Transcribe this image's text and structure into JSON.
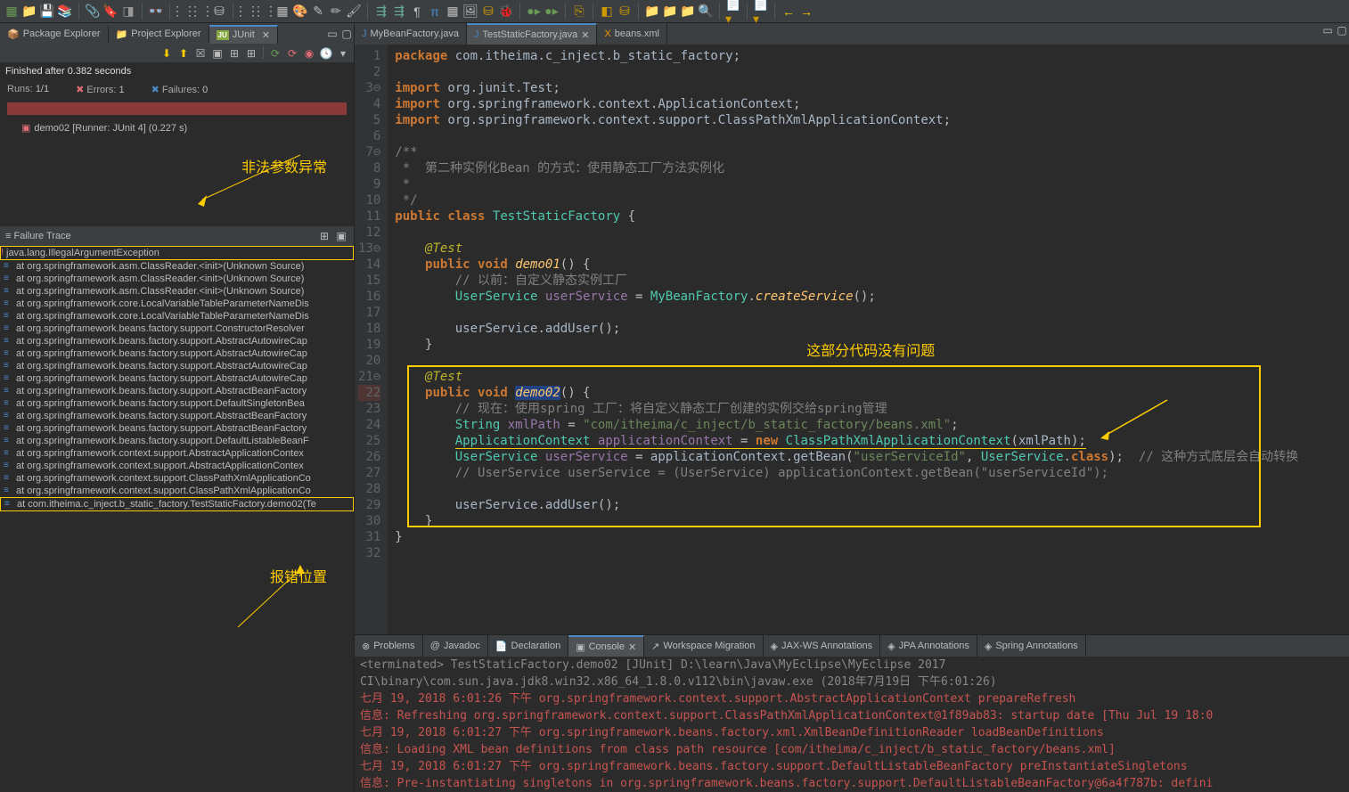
{
  "toolbar_icons": [
    "new",
    "folder",
    "save",
    "saveall",
    "sep",
    "attach",
    "tag",
    "build",
    "debug",
    "run",
    "sep2",
    "glasses",
    "docs",
    "indent",
    "outdent",
    "wrap",
    "sep3",
    "file",
    "file2",
    "grid",
    "palette",
    "edit",
    "pencil",
    "brush",
    "sep4",
    "run2",
    "pause",
    "para",
    "pi",
    "bold",
    "img",
    "db",
    "bug",
    "sep5",
    "play",
    "debug2",
    "sep6",
    "git",
    "sep7",
    "cube",
    "cubes",
    "sep8",
    "folder-g",
    "folder-y",
    "folder-o",
    "search",
    "sep9",
    "doc",
    "down",
    "sep10",
    "doc2",
    "down2",
    "sep11",
    "back",
    "fwd"
  ],
  "left_tabs": [
    {
      "icon": "📦",
      "label": "Package Explorer",
      "active": false
    },
    {
      "icon": "📁",
      "label": "Project Explorer",
      "active": false
    },
    {
      "icon": "Ju",
      "label": "JUnit",
      "active": true
    }
  ],
  "junit": {
    "finished": "Finished after 0.382 seconds",
    "runs_label": "Runs:",
    "runs_val": "1/1",
    "errors_label": "Errors:",
    "errors_val": "1",
    "failures_label": "Failures:",
    "failures_val": "0",
    "test_item": "demo02 [Runner: JUnit 4] (0.227 s)",
    "annotation_exception": "非法参数异常",
    "failure_trace_header": "Failure Trace",
    "exception": "java.lang.IllegalArgumentException",
    "trace": [
      "at org.springframework.asm.ClassReader.<init>(Unknown Source)",
      "at org.springframework.asm.ClassReader.<init>(Unknown Source)",
      "at org.springframework.asm.ClassReader.<init>(Unknown Source)",
      "at org.springframework.core.LocalVariableTableParameterNameDis",
      "at org.springframework.core.LocalVariableTableParameterNameDis",
      "at org.springframework.beans.factory.support.ConstructorResolver",
      "at org.springframework.beans.factory.support.AbstractAutowireCap",
      "at org.springframework.beans.factory.support.AbstractAutowireCap",
      "at org.springframework.beans.factory.support.AbstractAutowireCap",
      "at org.springframework.beans.factory.support.AbstractAutowireCap",
      "at org.springframework.beans.factory.support.AbstractBeanFactory",
      "at org.springframework.beans.factory.support.DefaultSingletonBea",
      "at org.springframework.beans.factory.support.AbstractBeanFactory",
      "at org.springframework.beans.factory.support.AbstractBeanFactory",
      "at org.springframework.beans.factory.support.DefaultListableBeanF",
      "at org.springframework.context.support.AbstractApplicationContex",
      "at org.springframework.context.support.AbstractApplicationContex",
      "at org.springframework.context.support.ClassPathXmlApplicationCo",
      "at org.springframework.context.support.ClassPathXmlApplicationCo"
    ],
    "trace_own": "at com.itheima.c_inject.b_static_factory.TestStaticFactory.demo02(Te",
    "annotation_pos": "报错位置"
  },
  "editor_tabs": [
    {
      "icon": "J",
      "label": "MyBeanFactory.java",
      "active": false
    },
    {
      "icon": "J",
      "label": "TestStaticFactory.java",
      "active": true
    },
    {
      "icon": "X",
      "label": "beans.xml",
      "active": false
    }
  ],
  "code_lines": [
    1,
    2,
    3,
    4,
    5,
    6,
    7,
    8,
    9,
    10,
    11,
    12,
    13,
    14,
    15,
    16,
    17,
    18,
    19,
    20,
    21,
    22,
    23,
    24,
    25,
    26,
    27,
    28,
    29,
    30,
    31,
    32
  ],
  "code": {
    "pkg": "package",
    "pkg_path": "com.itheima.c_inject.b_static_factory",
    "imp": "import",
    "imp1": "org.junit.Test",
    "imp2": "org.springframework.context.ApplicationContext",
    "imp3": "org.springframework.context.support.ClassPathXmlApplicationContext",
    "c1": "/**",
    "c2": " *  第二种实例化Bean 的方式：使用静态工厂方法实例化",
    "c3": " * ",
    "c4": " */",
    "pub": "public",
    "cls": "class",
    "clsname": "TestStaticFactory",
    "test_ann": "@Test",
    "void": "void",
    "m1": "demo01",
    "m2": "demo02",
    "c5": "// 以前：自定义静态实例工厂",
    "us": "UserService",
    "var_us": "userService",
    "mbf": "MyBeanFactory",
    "cs": "createService",
    "addUser": "addUser",
    "c6": "// 现在：使用spring 工厂：将自定义静态工厂创建的实例交给spring管理",
    "str": "String",
    "xmlPath": "xmlPath",
    "xmlVal": "\"com/itheima/c_inject/b_static_factory/beans.xml\"",
    "ac": "ApplicationContext",
    "acv": "applicationContext",
    "new": "new",
    "cpxac": "ClassPathXmlApplicationContext",
    "getBean": "getBean",
    "usid": "\"userServiceId\"",
    "classkw": "class",
    "c7": "// 这种方式底层会自动转换",
    "c8": "// UserService userService = (UserService) applicationContext.getBean(\"userServiceId\");"
  },
  "annotation_code": "这部分代码没有问题",
  "console_tabs": [
    {
      "icon": "⊗",
      "label": "Problems"
    },
    {
      "icon": "@",
      "label": "Javadoc"
    },
    {
      "icon": "📄",
      "label": "Declaration"
    },
    {
      "icon": "▣",
      "label": "Console",
      "active": true
    },
    {
      "icon": "↗",
      "label": "Workspace Migration"
    },
    {
      "icon": "◈",
      "label": "JAX-WS Annotations"
    },
    {
      "icon": "◈",
      "label": "JPA Annotations"
    },
    {
      "icon": "◈",
      "label": "Spring Annotations"
    }
  ],
  "console": {
    "term": "<terminated> TestStaticFactory.demo02 [JUnit] D:\\learn\\Java\\MyEclipse\\MyEclipse 2017 CI\\binary\\com.sun.java.jdk8.win32.x86_64_1.8.0.v112\\bin\\javaw.exe (2018年7月19日 下午6:01:26)",
    "l1": "七月 19, 2018 6:01:26 下午 org.springframework.context.support.AbstractApplicationContext prepareRefresh",
    "l2": "信息: Refreshing org.springframework.context.support.ClassPathXmlApplicationContext@1f89ab83: startup date [Thu Jul 19 18:0",
    "l3": "七月 19, 2018 6:01:27 下午 org.springframework.beans.factory.xml.XmlBeanDefinitionReader loadBeanDefinitions",
    "l4": "信息: Loading XML bean definitions from class path resource [com/itheima/c_inject/b_static_factory/beans.xml]",
    "l5": "七月 19, 2018 6:01:27 下午 org.springframework.beans.factory.support.DefaultListableBeanFactory preInstantiateSingletons",
    "l6": "信息: Pre-instantiating singletons in org.springframework.beans.factory.support.DefaultListableBeanFactory@6a4f787b: defini"
  }
}
